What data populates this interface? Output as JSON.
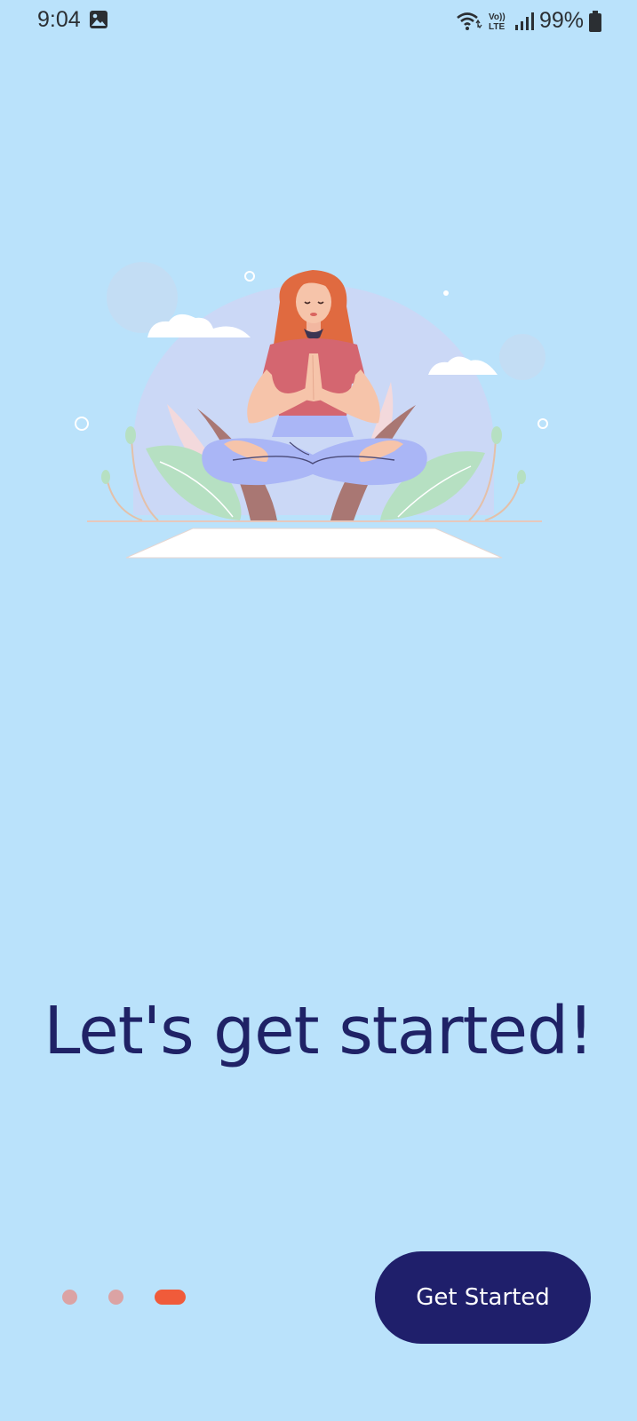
{
  "status_bar": {
    "time": "9:04",
    "network_label": "Vo)) LTE",
    "battery_percent": "99%",
    "icons": [
      "gallery-icon",
      "wifi-icon",
      "volte-icon",
      "signal-icon",
      "battery-icon"
    ]
  },
  "headline": "Let's get started!",
  "pager": {
    "page_count": 3,
    "active_index": 2,
    "colors": {
      "inactive": "#dba3a4",
      "active": "#f05b3a"
    }
  },
  "get_started_button": {
    "label": "Get Started"
  },
  "colors": {
    "background": "#bae2fb",
    "headline": "#1f2266",
    "button": "#1f1f6b"
  }
}
